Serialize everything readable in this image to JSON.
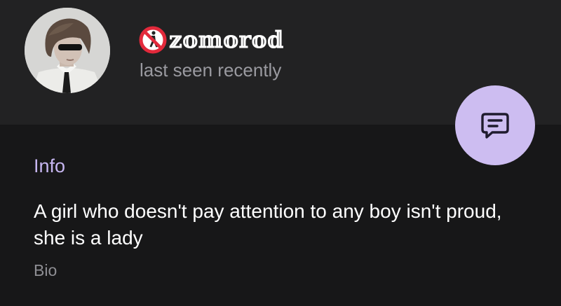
{
  "profile": {
    "display_name": "𝕫𝕠𝕞𝕠𝕣𝕠𝕕",
    "status": "last seen recently",
    "avatar": "profile-photo"
  },
  "actions": {
    "message_icon": "message-icon"
  },
  "info": {
    "section_title": "Info",
    "bio": "A girl who doesn't pay attention to any boy isn't proud, she is a lady",
    "bio_label": "Bio"
  },
  "colors": {
    "accent": "#c6b6f0",
    "fab": "#cdbdf1",
    "header_bg": "#222223",
    "page_bg": "#171718"
  }
}
